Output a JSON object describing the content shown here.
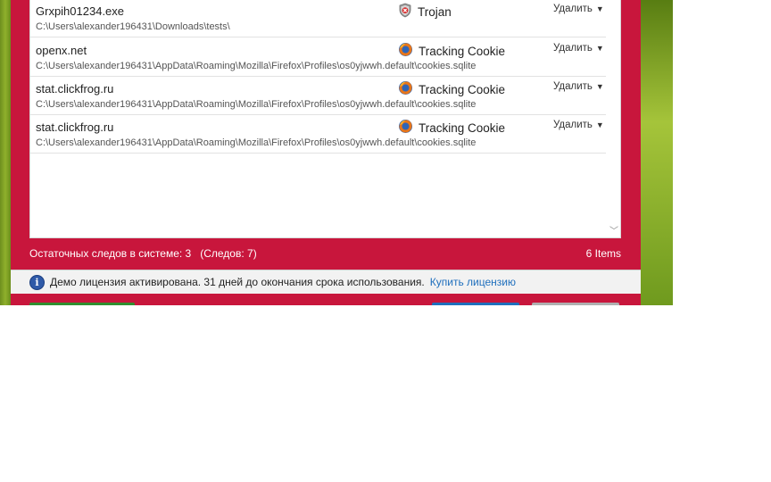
{
  "items": [
    {
      "name": "Grxpih01234.exe",
      "path": "C:\\Users\\alexander196431\\Downloads\\tests\\",
      "type": "Trojan",
      "icon": "shield-x-icon",
      "action": "Удалить"
    },
    {
      "name": "openx.net",
      "path": "C:\\Users\\alexander196431\\AppData\\Roaming\\Mozilla\\Firefox\\Profiles\\os0yjwwh.default\\cookies.sqlite",
      "type": "Tracking Cookie",
      "icon": "firefox-icon",
      "action": "Удалить"
    },
    {
      "name": "stat.clickfrog.ru",
      "path": "C:\\Users\\alexander196431\\AppData\\Roaming\\Mozilla\\Firefox\\Profiles\\os0yjwwh.default\\cookies.sqlite",
      "type": "Tracking Cookie",
      "icon": "firefox-icon",
      "action": "Удалить"
    },
    {
      "name": "stat.clickfrog.ru",
      "path": "C:\\Users\\alexander196431\\AppData\\Roaming\\Mozilla\\Firefox\\Profiles\\os0yjwwh.default\\cookies.sqlite",
      "type": "Tracking Cookie",
      "icon": "firefox-icon",
      "action": "Удалить"
    }
  ],
  "status": {
    "remaining": "Остаточных следов в системе: 3   (Следов: 7)",
    "count": "6 Items"
  },
  "info": {
    "message": "Демо лицензия активирована. 31 дней до окончания срока использования.",
    "link": "Купить лицензию"
  },
  "colors": {
    "window_bg": "#c8163c",
    "link": "#1f6fbd",
    "info_icon": "#2f5aa8"
  }
}
